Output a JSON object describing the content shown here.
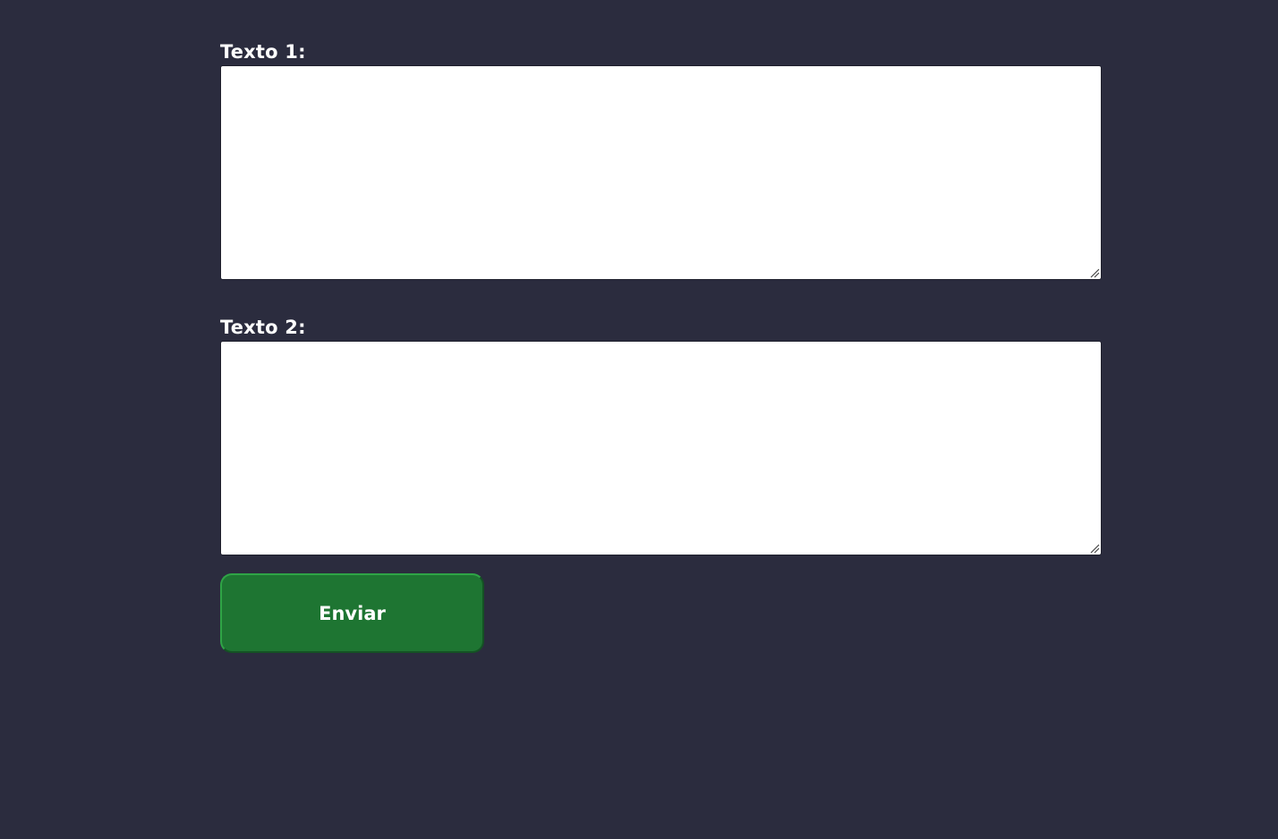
{
  "form": {
    "fields": [
      {
        "label": "Texto 1:",
        "value": "",
        "placeholder": ""
      },
      {
        "label": "Texto 2:",
        "value": "",
        "placeholder": ""
      }
    ],
    "submit_label": "Enviar"
  },
  "colors": {
    "background": "#2b2c3e",
    "textarea_background": "#ffffff",
    "button_background": "#1e7532",
    "button_border": "#2fa446",
    "label_text": "#ffffff"
  }
}
